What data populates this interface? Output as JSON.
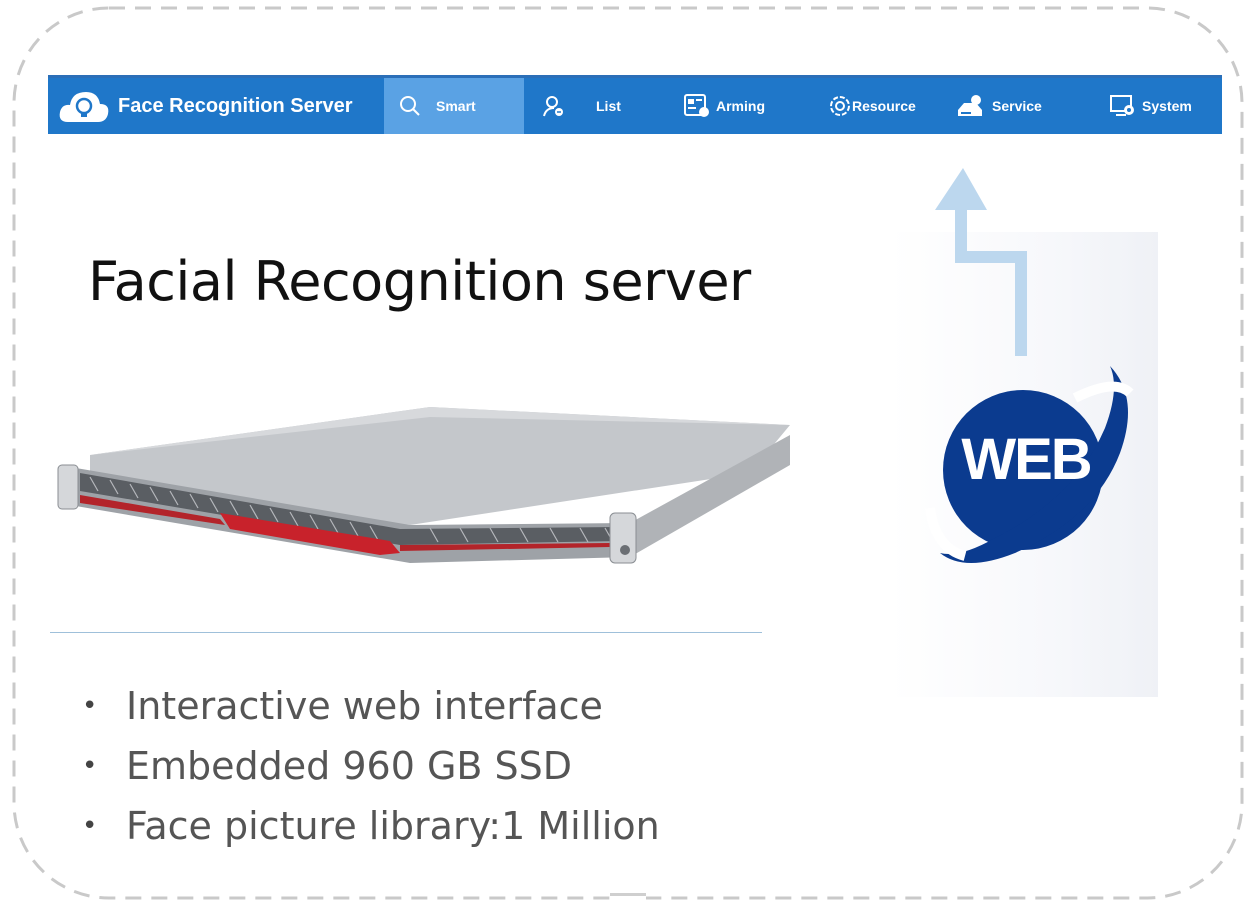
{
  "nav": {
    "title": "Face Recognition Server",
    "items": [
      {
        "label": "Smart",
        "icon": "search-icon",
        "active": true
      },
      {
        "label": "List",
        "icon": "person-list-icon"
      },
      {
        "label": "Arming",
        "icon": "arming-icon"
      },
      {
        "label": "Resource",
        "icon": "resource-gear-icon"
      },
      {
        "label": "Service",
        "icon": "service-icon"
      },
      {
        "label": "System",
        "icon": "system-settings-icon"
      }
    ]
  },
  "headline": "Facial Recognition server",
  "bullets": [
    "Interactive web interface",
    "Embedded 960 GB SSD",
    "Face picture library:1 Million"
  ],
  "web_badge": "WEB",
  "colors": {
    "nav_bg": "#1f77c9",
    "nav_active": "#5aa2e4",
    "arrow": "#bcd7ee",
    "web_blue": "#0b3b8f"
  }
}
